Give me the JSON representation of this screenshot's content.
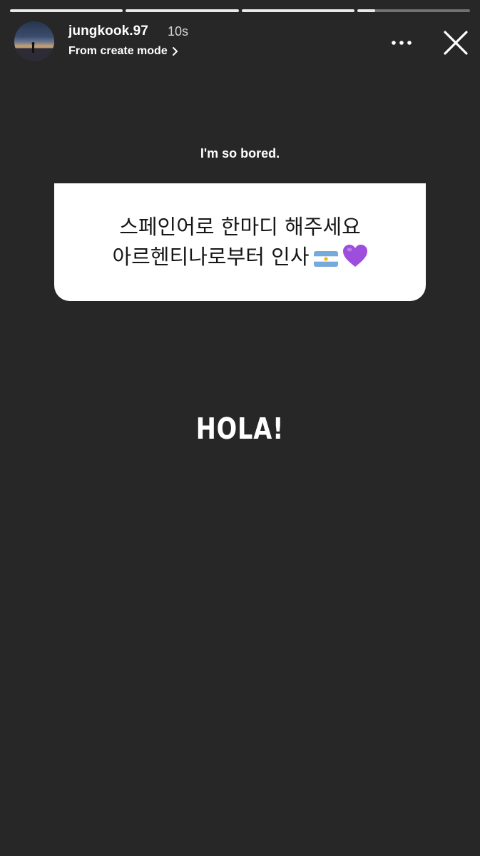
{
  "progress": [
    1,
    1,
    1,
    0.16
  ],
  "header": {
    "username": "jungkook.97",
    "time": "10s",
    "subtitle": "From create mode",
    "subtitle_icon": "chevron-right-icon",
    "more_icon": "more-horizontal-icon",
    "close_icon": "close-icon"
  },
  "question_prompt": "I'm so bored.",
  "question": {
    "line1": "스페인어로 한마디 해주세요",
    "line2": "아르헨티나로부터 인사",
    "emojis": [
      "argentina-flag-icon",
      "purple-heart-icon"
    ]
  },
  "answer": "HOLA!",
  "colors": {
    "background": "#272727",
    "sticker_bg": "#ffffff",
    "heart": "#9d4edd"
  }
}
